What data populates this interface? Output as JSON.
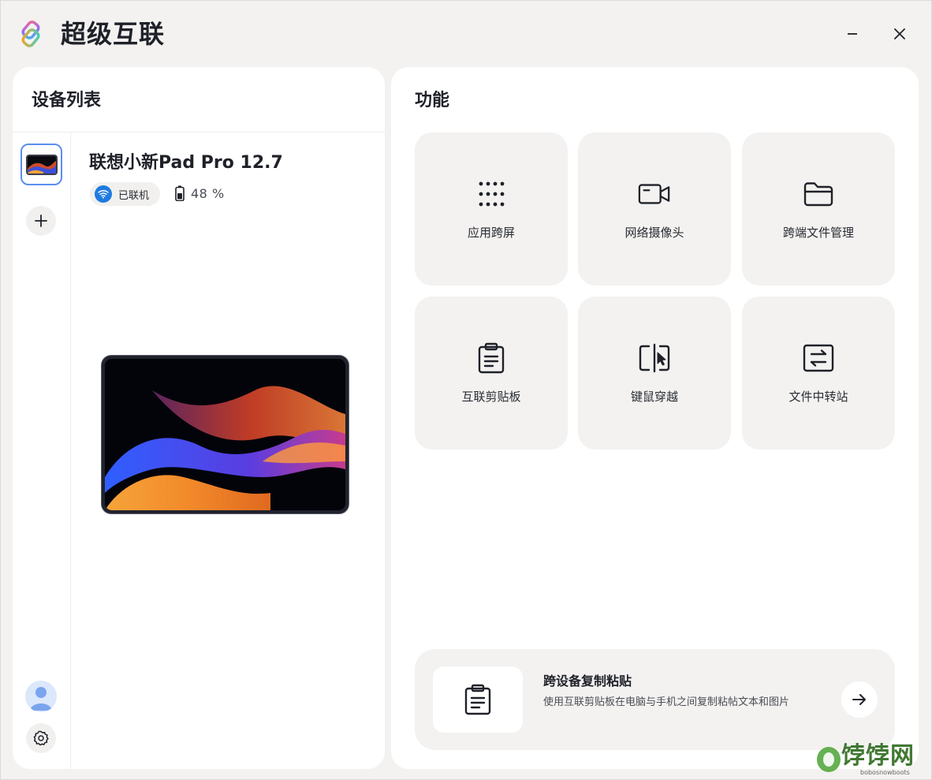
{
  "app": {
    "title": "超级互联"
  },
  "device_panel": {
    "title": "设备列表",
    "device": {
      "name": "联想小新Pad Pro 12.7",
      "status": "已联机",
      "battery": "48 %"
    }
  },
  "feature_panel": {
    "title": "功能",
    "features": [
      {
        "label": "应用跨屏",
        "icon": "grid-icon"
      },
      {
        "label": "网络摄像头",
        "icon": "camera-icon"
      },
      {
        "label": "跨端文件管理",
        "icon": "folder-icon"
      },
      {
        "label": "互联剪贴板",
        "icon": "clipboard-icon"
      },
      {
        "label": "键鼠穿越",
        "icon": "mouse-crossover-icon"
      },
      {
        "label": "文件中转站",
        "icon": "transfer-icon"
      }
    ],
    "promo": {
      "title": "跨设备复制粘贴",
      "description": "使用互联剪贴板在电脑与手机之间复制粘帖文本和图片"
    }
  },
  "watermark": {
    "text": "饽饽网",
    "sub": "bobosnowboots"
  },
  "colors": {
    "accent": "#5b8ef0",
    "wifi": "#1f7ae0",
    "background": "#f3f2f0",
    "panel": "#ffffff"
  }
}
